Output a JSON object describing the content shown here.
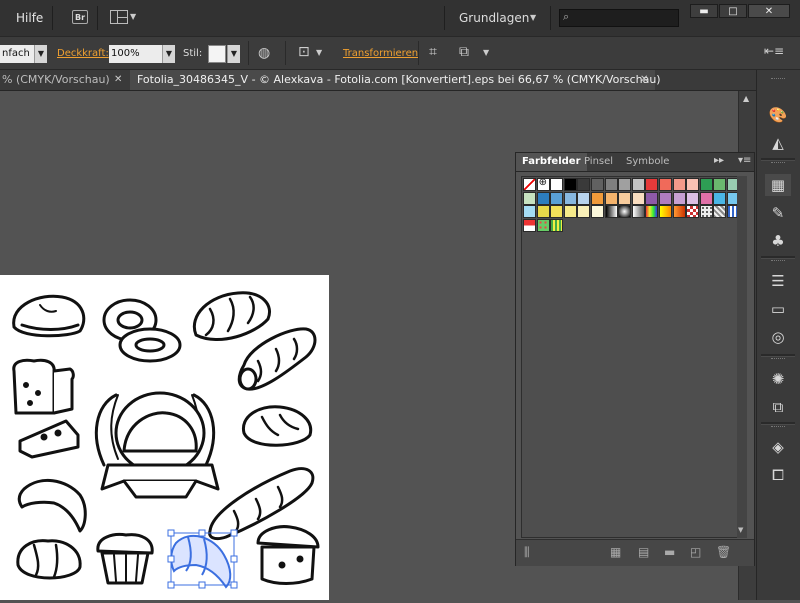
{
  "menubar": {
    "help_menu": "Hilfe",
    "bridge_label": "Br",
    "workspace_label": "Grundlagen",
    "minimize_label": "▬",
    "maximize_label": "□",
    "close_label": "✕"
  },
  "controlbar": {
    "stroke_profile": "nfach",
    "opacity_label": "Deckkraft:",
    "opacity_value": "100%",
    "style_label": "Stil:",
    "transform_label": "Transformieren"
  },
  "tabs": {
    "tab1_label": "% (CMYK/Vorschau)",
    "tab2_label": "Fotolia_30486345_V - © Alexkava - Fotolia.com [Konvertiert].eps bei 66,67 % (CMYK/Vorschau)",
    "close_glyph": "✕"
  },
  "panel": {
    "tabs": [
      "Farbfelder",
      "Pinsel",
      "Symbole"
    ],
    "active_tab": "Farbfelder",
    "swatch_rows": [
      [
        "none",
        "registration",
        "#ffffff",
        "#000000",
        "#3a3a3a",
        "#616161",
        "#808080",
        "#a0a0a0",
        "#c4c4c4",
        "#e63a3a",
        "#f06a5a",
        "#f49a8a",
        "#f9c1b4",
        "#2e9e54",
        "#6ab86e",
        "#98ccb0"
      ],
      [
        "#c7e2c0",
        "#2c7dbf",
        "#5aa0d6",
        "#88b8e0",
        "#b8d4ee",
        "#f09a3a",
        "#f4b36c",
        "#f7cb9c",
        "#f9ddc0",
        "#8e5aa8",
        "#b07cc0",
        "#c7a0d2",
        "#ddc0e4",
        "#e070a8",
        "#4ab6e6",
        "#76c8ee"
      ],
      [
        "#a4dcf4",
        "#e8d84a",
        "#f2e05a",
        "#f6ea8a",
        "#f9f0b8",
        "#fcf8dc",
        "grad-bw",
        "grad-radial",
        "grad-gray",
        "grad-rainbow",
        "grad-yellow",
        "grad-orange",
        "pattern-check",
        "pattern-dots",
        "pattern-stripe",
        "pattern-plaid"
      ],
      [
        "pattern-flag",
        "pattern-flowers",
        "pattern-grass"
      ]
    ]
  },
  "colors": {
    "menubar_bg": "#323232",
    "canvas_bg": "#535353",
    "accent_link": "#f0a030",
    "selection": "#3b6fe0"
  },
  "dock": {
    "icons": [
      "color-palette-icon",
      "color-guide-icon",
      "swatches-icon",
      "brushes-icon",
      "symbols-icon",
      "stroke-icon",
      "gradient-icon",
      "transparency-icon",
      "appearance-icon",
      "graphic-styles-icon",
      "layers-icon",
      "artboards-icon"
    ]
  }
}
